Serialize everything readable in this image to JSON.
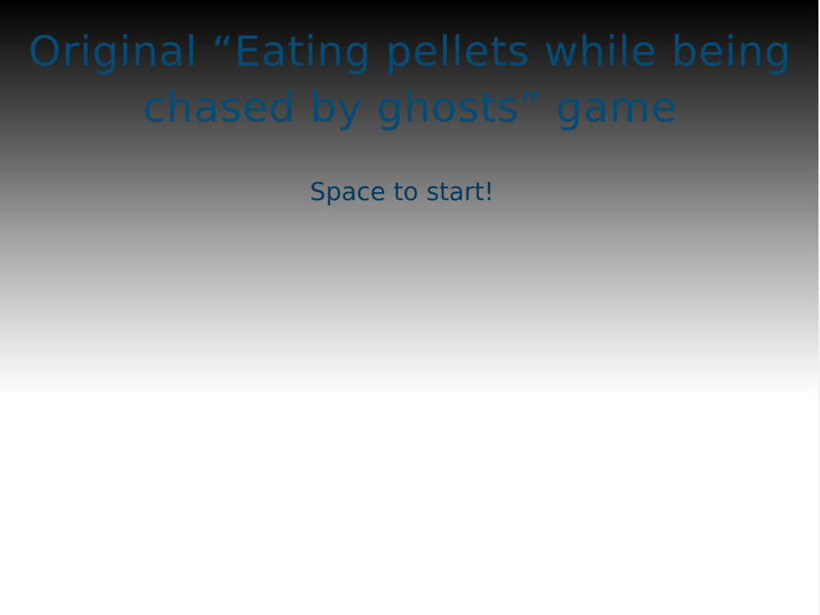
{
  "game": {
    "title": "Original “Eating pellets while being chased by ghosts” game",
    "prompt": "Space to start!"
  },
  "colors": {
    "title_text": "#074a73",
    "prompt_text": "#073a5c",
    "background_top": "#000000",
    "background_bottom": "#ffffff"
  }
}
